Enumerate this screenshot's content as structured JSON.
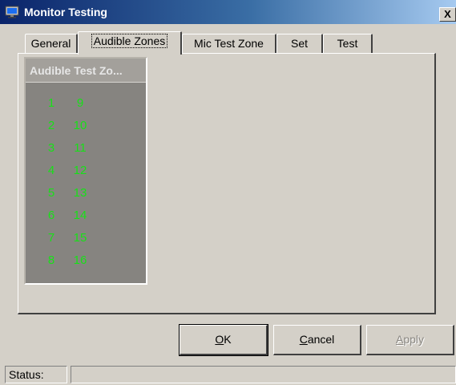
{
  "window": {
    "title": "Monitor Testing",
    "close_label": "X",
    "icon": "monitor-icon"
  },
  "tabs": [
    {
      "label": "General",
      "active": false
    },
    {
      "label": "Audible Zones",
      "active": true
    },
    {
      "label": "Mic Test Zone",
      "active": false
    },
    {
      "label": "Set",
      "active": false
    },
    {
      "label": "Test",
      "active": false
    }
  ],
  "zones_panel": {
    "title": "Audible Test Zo...",
    "left_column": [
      "1",
      "2",
      "3",
      "4",
      "5",
      "6",
      "7",
      "8"
    ],
    "right_column": [
      "9",
      "10",
      "11",
      "12",
      "13",
      "14",
      "15",
      "16"
    ],
    "number_color": "#18e018"
  },
  "buttons": {
    "ok_mnemonic": "O",
    "ok_rest": "K",
    "cancel_mnemonic": "C",
    "cancel_rest": "ancel",
    "apply_mnemonic": "A",
    "apply_rest": "pply",
    "apply_enabled": false
  },
  "status": {
    "label": "Status:",
    "value": ""
  }
}
